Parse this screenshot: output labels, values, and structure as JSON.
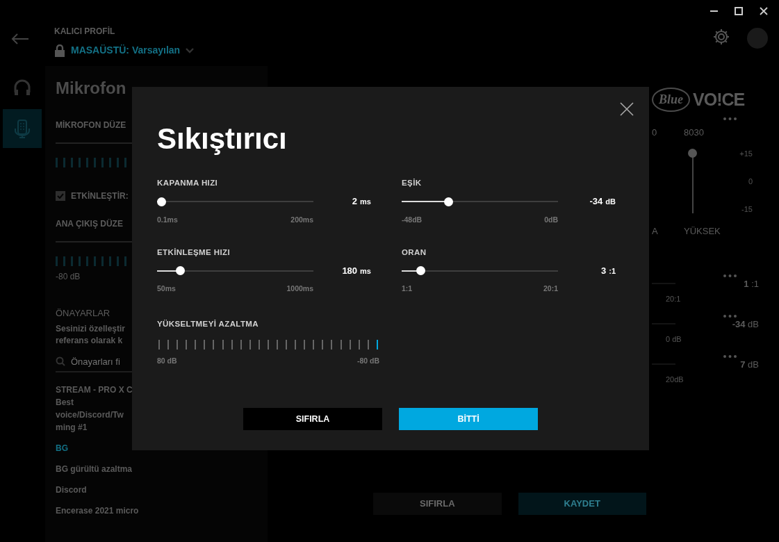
{
  "profile": {
    "label": "KALICI PROFİL",
    "name": "MASAÜSTÜ: Varsayılan"
  },
  "nav": [
    {
      "kind": "headphones",
      "selected": false
    },
    {
      "kind": "microphone",
      "selected": true
    }
  ],
  "panel": {
    "title": "Mikrofon",
    "mic_level_label": "MİKROFON DÜZE",
    "enable": {
      "label": "ETKİNLEŞTİR:",
      "checked": true
    },
    "output_label": "ANA ÇIKIŞ DÜZE",
    "output_reading": "-80 dB",
    "presets_title": "ÖNAYARLAR",
    "presets_desc": [
      "Sesinizi özelleştir",
      "referans olarak k"
    ],
    "search": {
      "placeholder": "Önayarları fi"
    },
    "presets": [
      {
        "lines": [
          "STREAM - PRO X C",
          "Best",
          "voice/Discord/Tw",
          "ming #1"
        ],
        "selected": false
      },
      {
        "lines": [
          "BG"
        ],
        "selected": true
      },
      {
        "lines": [
          "BG gürültü azaltma"
        ],
        "selected": false
      },
      {
        "lines": [
          "Discord"
        ],
        "selected": false
      },
      {
        "lines": [
          "Encerase 2021 micro"
        ],
        "selected": false
      }
    ]
  },
  "logo": {
    "badge": "Blue",
    "text": "VO!CE"
  },
  "eq": {
    "freq_cut": "0",
    "freq": "8030",
    "scale": [
      "+15",
      "0",
      "-15"
    ],
    "band_cut": "A",
    "band": "YÜKSEK",
    "level": 1.0
  },
  "readouts": [
    {
      "value": "1",
      "unit": ":1",
      "scale_end": "20:1"
    },
    {
      "value": "-34",
      "unit": "dB",
      "scale_end": "0 dB"
    },
    {
      "value": "7",
      "unit": "dB",
      "scale_end": "20dB"
    }
  ],
  "page_buttons": [
    {
      "label": "SIFIRLA",
      "kind": "secondary"
    },
    {
      "label": "KAYDET",
      "kind": "primary"
    }
  ],
  "dialog": {
    "title": "Sıkıştırıcı",
    "sliders": [
      {
        "label": "KAPANMA HIZI",
        "value": "2",
        "unit": "ms",
        "min": "0.1ms",
        "max": "200ms",
        "level": 0.03
      },
      {
        "label": "EŞİK",
        "value": "-34",
        "unit": "dB",
        "min": "-48dB",
        "max": "0dB",
        "level": 0.3
      },
      {
        "label": "ETKİNLEŞME HIZI",
        "value": "180",
        "unit": "ms",
        "min": "50ms",
        "max": "1000ms",
        "level": 0.15
      },
      {
        "label": "ORAN",
        "value": "3",
        "unit": ":1",
        "min": "1:1",
        "max": "20:1",
        "level": 0.12
      }
    ],
    "meter": {
      "label": "YÜKSELTMEYİ AZALTMA",
      "min": "80 dB",
      "max": "-80 dB",
      "level": 0.04
    },
    "buttons": [
      {
        "label": "SIFIRLA",
        "kind": "secondary"
      },
      {
        "label": "BİTTİ",
        "kind": "primary"
      }
    ]
  }
}
